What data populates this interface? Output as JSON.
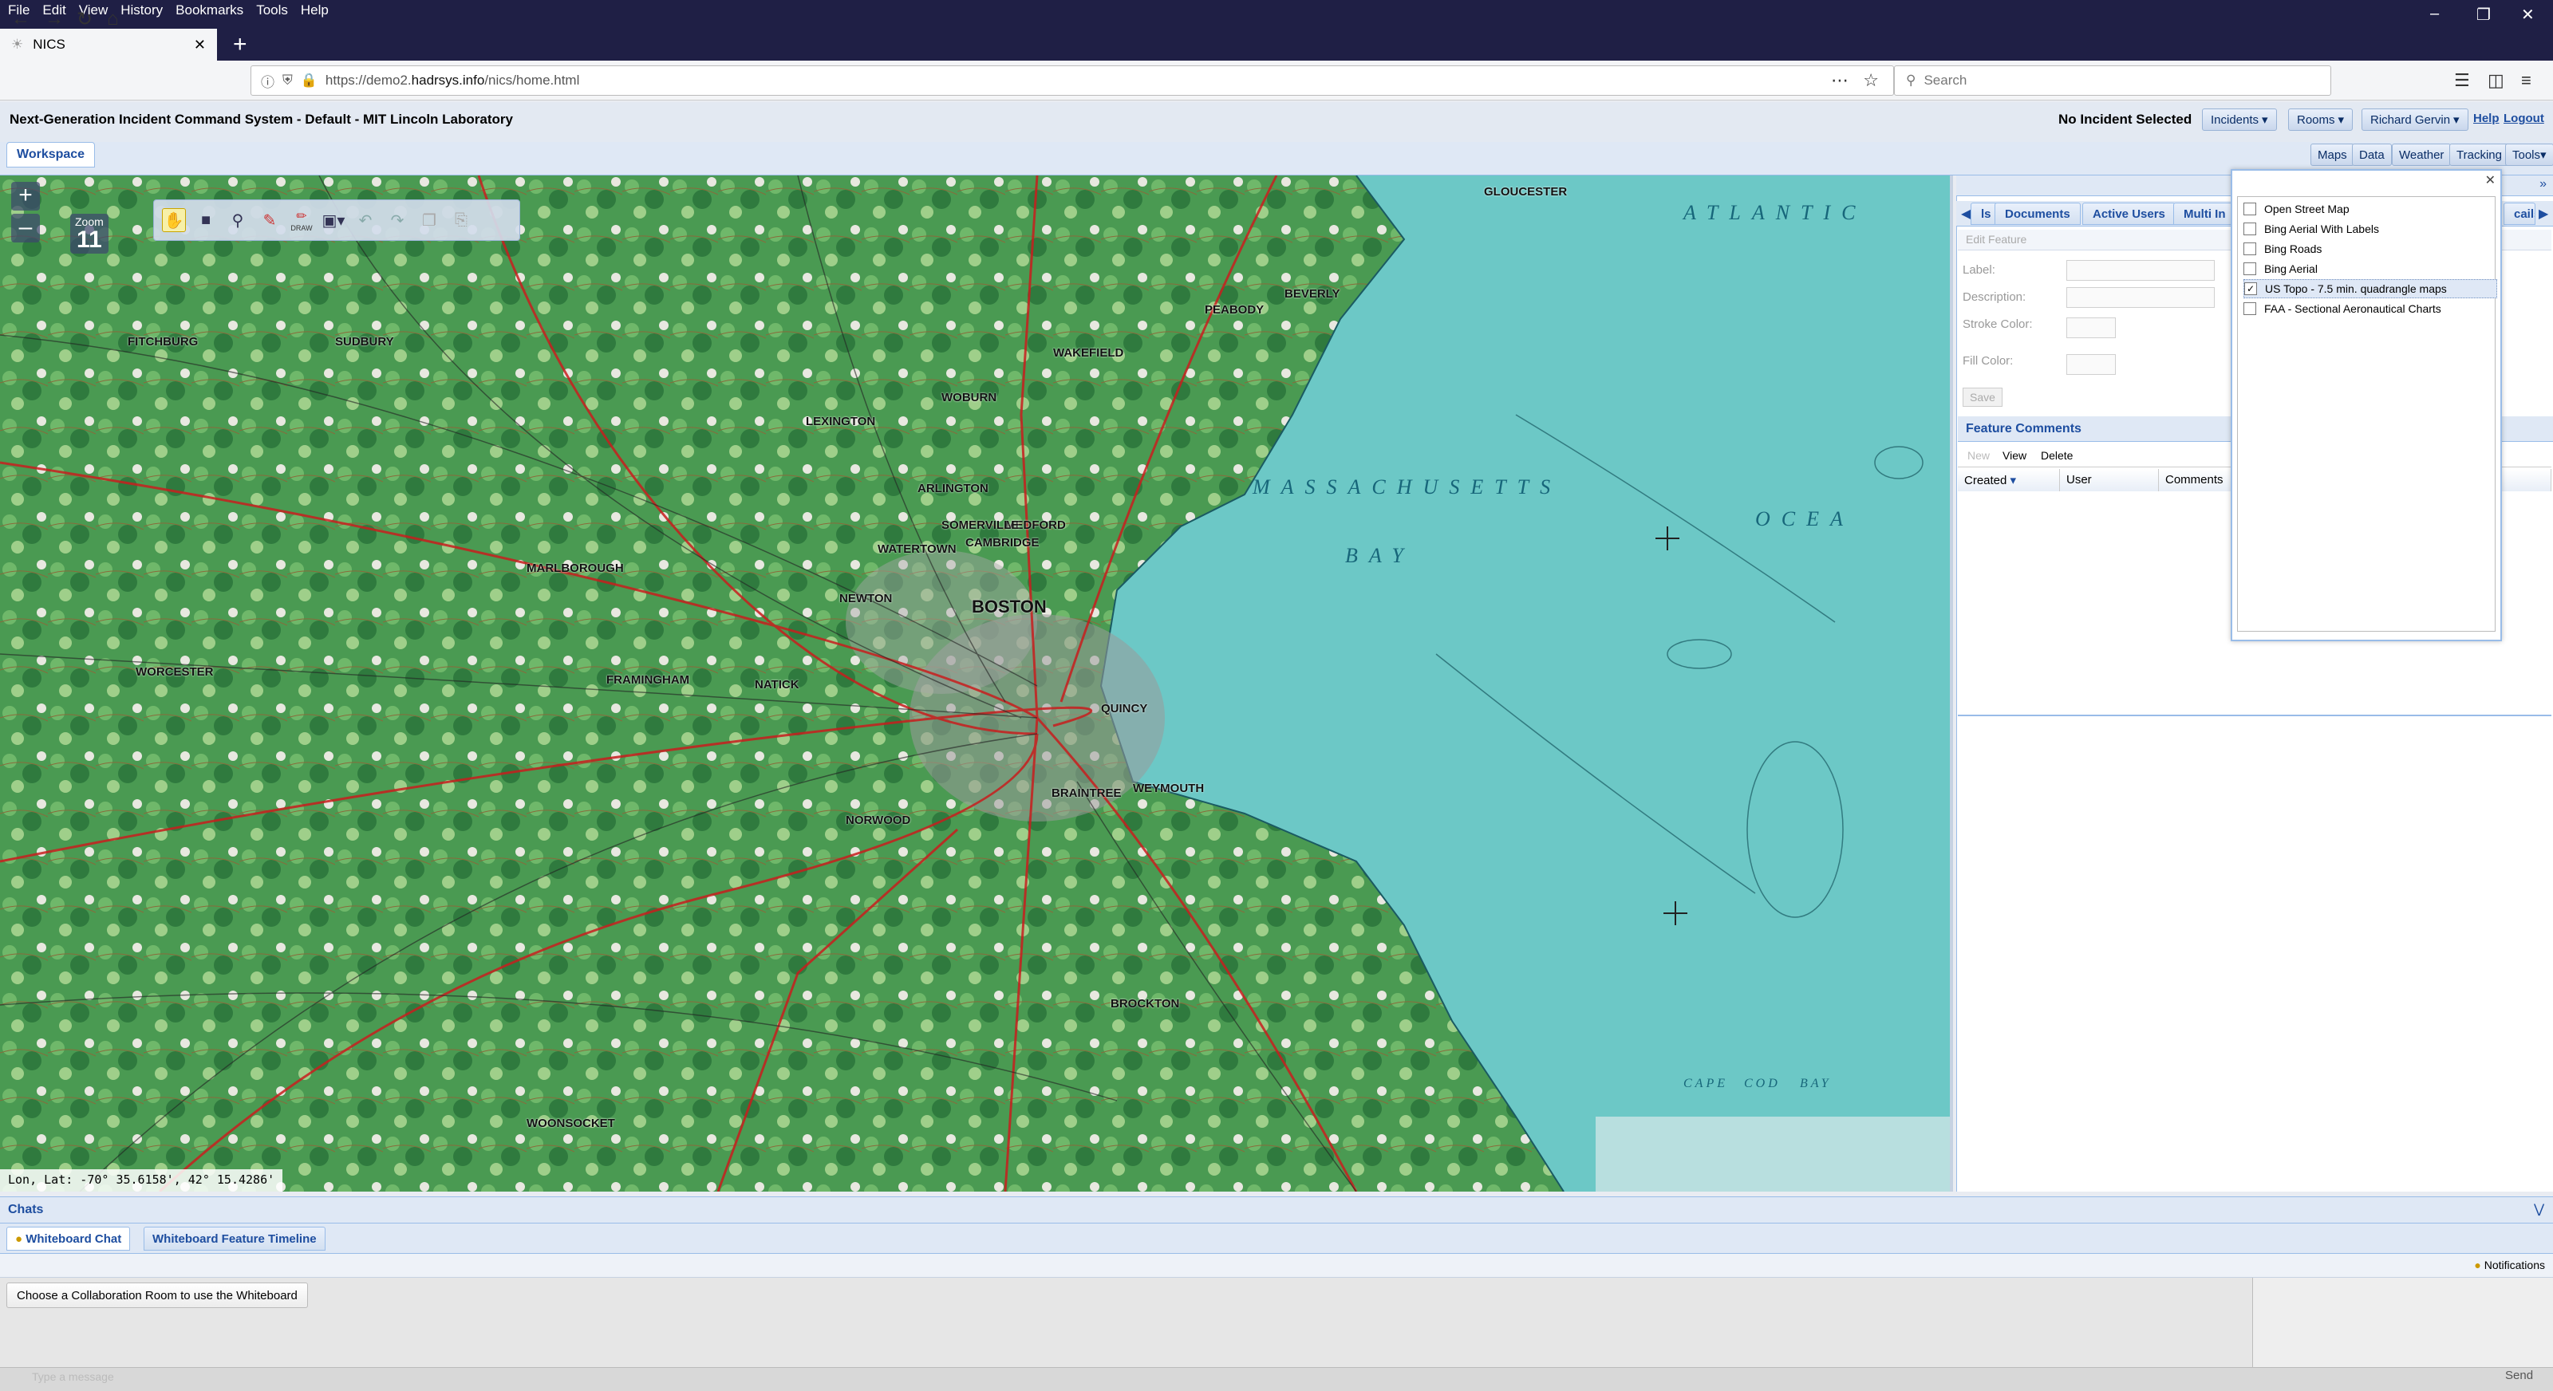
{
  "browser": {
    "menu": [
      "File",
      "Edit",
      "View",
      "History",
      "Bookmarks",
      "Tools",
      "Help"
    ],
    "tab_title": "NICS",
    "url_prefix": "https://demo2.",
    "url_host": "hadrsys.info",
    "url_path": "/nics/home.html",
    "search_placeholder": "Search"
  },
  "app": {
    "title": "Next-Generation Incident Command System - Default - MIT Lincoln Laboratory",
    "incident_status": "No Incident Selected",
    "menus": [
      "Incidents",
      "Rooms",
      "Richard Gervin"
    ],
    "links": [
      "Help",
      "Logout"
    ],
    "workspace_tab": "Workspace",
    "right_toolbar": [
      "Maps",
      "Data",
      "Weather",
      "Tracking",
      "Tools"
    ]
  },
  "map": {
    "zoom_label": "Zoom",
    "zoom_level": "11",
    "coords": "Lon, Lat: -70° 35.6158', 42° 15.4286'",
    "labels": [
      "ATLANTIC",
      "MASSACHUSETTS",
      "BAY",
      "OCEA",
      "CAPE",
      "COD",
      "BAY"
    ],
    "towns": [
      "GLOUCESTER",
      "BEVERLY",
      "PEABODY",
      "WAKEFIELD",
      "WOBURN",
      "LEXINGTON",
      "ARLINGTON",
      "MEDFORD",
      "SOMERVILLE",
      "CAMBRIDGE",
      "BOSTON",
      "NEWTON",
      "WATERTOWN",
      "FRAMINGHAM",
      "NATICK",
      "WORCESTER",
      "MARLBOROUGH",
      "BROCKTON",
      "BRAINTREE",
      "WEYMOUTH",
      "QUINCY",
      "SUDBURY",
      "WOONSOCKET",
      "NORWOOD",
      "FITCHBURG"
    ],
    "draw_tools": [
      "pan",
      "select-rect",
      "zoom",
      "erase",
      "draw",
      "image",
      "undo",
      "redo",
      "copy",
      "paste"
    ],
    "draw_label": "DRAW"
  },
  "right_panel": {
    "tabs": [
      "ls",
      "Documents",
      "Active Users",
      "Multi In",
      "cails"
    ],
    "edit_feature": "Edit Feature",
    "label_field": "Label:",
    "description_field": "Description:",
    "stroke_color": "Stroke Color:",
    "fill_color": "Fill Color:",
    "save": "Save",
    "feature_comments": "Feature Comments",
    "comment_actions": [
      "New",
      "View",
      "Delete"
    ],
    "grid_columns": [
      "Created",
      "User",
      "Comments"
    ]
  },
  "layers": {
    "items": [
      {
        "label": "Open Street Map",
        "checked": false
      },
      {
        "label": "Bing Aerial With Labels",
        "checked": false
      },
      {
        "label": "Bing Roads",
        "checked": false
      },
      {
        "label": "Bing Aerial",
        "checked": false
      },
      {
        "label": "US Topo - 7.5 min. quadrangle maps",
        "checked": true
      },
      {
        "label": "FAA - Sectional Aeronautical Charts",
        "checked": false
      }
    ]
  },
  "bottom": {
    "chats_title": "Chats",
    "tabs": [
      "Whiteboard Chat",
      "Whiteboard Feature Timeline"
    ],
    "notifications": "Notifications",
    "choose_room": "Choose a Collaboration Room to use the Whiteboard",
    "message_placeholder": "Type a message",
    "send": "Send"
  }
}
